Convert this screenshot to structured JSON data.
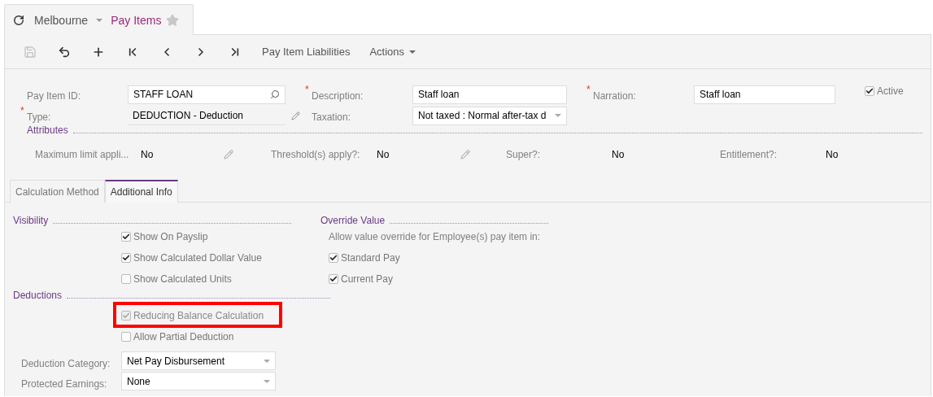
{
  "breadcrumb": {
    "company": "Melbourne",
    "screen": "Pay Items",
    "favorite": false
  },
  "toolbar_icons": [
    {
      "kind": "save",
      "disabled": true
    },
    {
      "kind": "undo",
      "disabled": false
    },
    {
      "kind": "add",
      "disabled": false
    },
    {
      "kind": "first",
      "disabled": false
    },
    {
      "kind": "previous",
      "disabled": false
    },
    {
      "kind": "next",
      "disabled": false
    },
    {
      "kind": "last",
      "disabled": false
    }
  ],
  "toolbar_actions": [
    {
      "label": "Pay Item Liabilities",
      "kind": "link"
    },
    {
      "label": "Actions",
      "kind": "menu"
    }
  ],
  "header": {
    "rows": [
      [
        {
          "label": "Pay Item ID:",
          "value": "STAFF LOAN",
          "kind": "lookup"
        },
        {
          "required_mark": "*",
          "label": "Description:",
          "value": "Staff loan",
          "kind": "text"
        },
        {
          "required_mark": "*",
          "label": "Narration:",
          "value": "Staff loan",
          "kind": "text"
        }
      ],
      [
        {
          "required_mark": "*",
          "label": "Type:",
          "value": "DEDUCTION - Deduction",
          "kind": "readonly"
        },
        {
          "label": "Taxation:",
          "value": "Not taxed : Normal after-tax d",
          "kind": "select"
        }
      ]
    ],
    "active": {
      "label": "Active",
      "checked": true
    }
  },
  "attributes": {
    "title": "Attributes",
    "items": [
      {
        "label": "Maximum limit appli...",
        "value": "No",
        "editable": true
      },
      {
        "label": "Threshold(s) apply?:",
        "value": "No",
        "editable": true
      },
      {
        "label": "Super?:",
        "value": "No",
        "editable": false
      },
      {
        "label": "Entitlement?:",
        "value": "No",
        "editable": false
      }
    ]
  },
  "tabs": [
    {
      "label": "Calculation Method",
      "selected": false
    },
    {
      "label": "Additional Info",
      "selected": true
    }
  ],
  "visibility": {
    "title": "Visibility",
    "checkboxes": [
      {
        "label": "Show On Payslip",
        "checked": true,
        "disabled": false,
        "highlighted": false
      },
      {
        "label": "Show Calculated Dollar Value",
        "checked": true,
        "disabled": false,
        "highlighted": false
      },
      {
        "label": "Show Calculated Units",
        "checked": false,
        "disabled": false,
        "highlighted": false
      }
    ]
  },
  "override": {
    "title": "Override Value",
    "note": "Allow value override for Employee(s) pay item in:",
    "checkboxes": [
      {
        "label": "Standard Pay",
        "checked": true,
        "disabled": false,
        "highlighted": false
      },
      {
        "label": "Current Pay",
        "checked": true,
        "disabled": false,
        "highlighted": false
      }
    ]
  },
  "deductions": {
    "title": "Deductions",
    "checkboxes": [
      {
        "label": "Reducing Balance Calculation",
        "checked": true,
        "disabled": true,
        "highlighted": true
      },
      {
        "label": "Allow Partial Deduction",
        "checked": false,
        "disabled": false,
        "highlighted": false
      }
    ],
    "selects": [
      {
        "label": "Deduction Category:",
        "value": "Net Pay Disbursement"
      },
      {
        "label": "Protected Earnings:",
        "value": "None"
      }
    ]
  }
}
